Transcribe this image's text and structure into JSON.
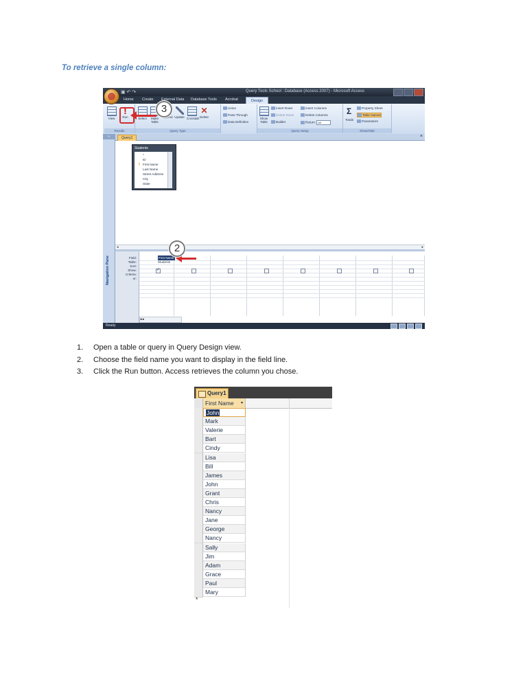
{
  "heading": "To retrieve a single column:",
  "screenshot1": {
    "qat_icons": "▣ ↶ ↷",
    "window_title": "Query Tools   School : Database (Access 2007) - Microsoft Access",
    "tabs": [
      "Home",
      "Create",
      "External Data",
      "Database Tools",
      "Acrobat",
      "Design"
    ],
    "ribbon": {
      "results_buttons": [
        "View",
        "Run"
      ],
      "results_label": "Results",
      "query_type_buttons": [
        "Select",
        "Make Table",
        "Append",
        "Update",
        "Crosstab",
        "Delete"
      ],
      "query_type_small": [
        "Union",
        "Pass-Through",
        "Data Definition"
      ],
      "query_type_label": "Query Type",
      "show_table": "Show Table",
      "setup_small": [
        "Insert Rows",
        "Delete Rows",
        "Builder",
        "Insert Columns",
        "Delete Columns",
        "Return:"
      ],
      "return_value": "All",
      "setup_label": "Query Setup",
      "totals": "Totals",
      "show_hide_small": [
        "Property Sheet",
        "Table Names",
        "Parameters"
      ],
      "show_hide_label": "Show/Hide"
    },
    "nav_pane": "Navigation Pane",
    "doc_tab": "Query1",
    "table_box": {
      "title": "Students",
      "fields": [
        "*",
        "ID",
        "First Name",
        "Last Name",
        "Street Address",
        "City",
        "State"
      ]
    },
    "grid_row_labels": [
      "Field:",
      "Table:",
      "Sort:",
      "Show:",
      "Criteria:",
      "or:"
    ],
    "field_value": "First Name",
    "table_value": "Students",
    "status": "Ready",
    "callout_run": "3",
    "callout_field": "2"
  },
  "steps": [
    {
      "num": "1.",
      "text": "Open a table or query in Query Design view."
    },
    {
      "num": "2.",
      "text": "Choose the field name you want to display in the field line."
    },
    {
      "num": "3.",
      "text": "Click the Run button. Access retrieves the column you chose."
    }
  ],
  "screenshot2": {
    "tab_label": "Query1",
    "column_header": "First Name",
    "rows": [
      "John",
      "Mark",
      "Valerie",
      "Bart",
      "Cindy",
      "Lisa",
      "Bill",
      "James",
      "John",
      "Grant",
      "Chris",
      "Nancy",
      "Jane",
      "George",
      "Nancy",
      "Sally",
      "Jim",
      "Adam",
      "Grace",
      "Paul",
      "Mary"
    ],
    "new_record_marker": "*"
  }
}
